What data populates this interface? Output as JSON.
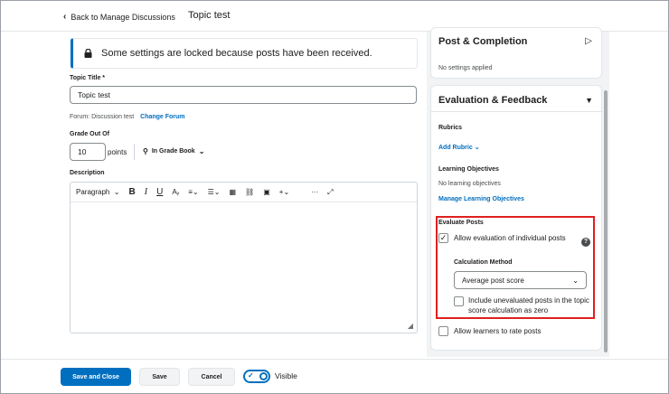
{
  "topbar": {
    "back_label": "Back to Manage Discussions",
    "title": "Topic test"
  },
  "lock_banner": {
    "text": "Some settings are locked because posts have been received."
  },
  "topic_title": {
    "label": "Topic Title *",
    "value": "Topic test"
  },
  "forum": {
    "text": "Forum: Discussion test",
    "change_link": "Change Forum"
  },
  "grade": {
    "label": "Grade Out Of",
    "value": "10",
    "unit": "points",
    "gradebook_label": "In Grade Book"
  },
  "description": {
    "label": "Description",
    "toolbar": {
      "format": "Paragraph",
      "bold": "B",
      "italic": "I",
      "underline": "U",
      "more": "···"
    }
  },
  "post_completion": {
    "title": "Post & Completion",
    "summary": "No settings applied"
  },
  "evaluation": {
    "title": "Evaluation & Feedback",
    "rubrics_label": "Rubrics",
    "add_rubric": "Add Rubric",
    "objectives_label": "Learning Objectives",
    "objectives_empty": "No learning objectives",
    "manage_objectives": "Manage Learning Objectives",
    "evaluate_posts_label": "Evaluate Posts",
    "allow_eval_label": "Allow evaluation of individual posts",
    "calc_method_label": "Calculation Method",
    "calc_method_value": "Average post score",
    "include_unevaluated_label": "Include unevaluated posts in the topic score calculation as zero",
    "allow_rate_label": "Allow learners to rate posts"
  },
  "footer": {
    "save_close": "Save and Close",
    "save": "Save",
    "cancel": "Cancel",
    "visible_label": "Visible"
  }
}
